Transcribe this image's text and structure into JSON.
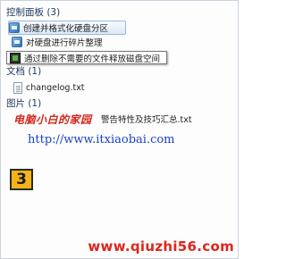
{
  "groups": {
    "control_panel": {
      "header": "控制面板 (3)",
      "items": [
        {
          "label": "创建并格式化硬盘分区",
          "icon": "control-panel-icon"
        },
        {
          "label": "对硬盘进行碎片整理",
          "icon": "control-panel-icon"
        },
        {
          "label": "通过删除不需要的文件释放磁盘空间",
          "icon": "disk-cleanup-icon"
        }
      ]
    },
    "documents": {
      "header": "文档 (1)",
      "items": [
        {
          "label": "changelog.txt",
          "icon": "text-document-icon"
        }
      ]
    },
    "pictures": {
      "header": "图片 (1)",
      "items": [
        {
          "label": "警告特性及技巧汇总.txt",
          "icon": "text-document-icon"
        }
      ]
    }
  },
  "overlay": {
    "site_name": "电脑小白的家园",
    "url": "http://www.itxiaobai.com",
    "step_number": "3",
    "watermark": "www.qiuzhi56.com"
  },
  "colors": {
    "header_text": "#1e395b",
    "highlight_border": "#9ab8dc",
    "overlay_red": "#d4271c",
    "url_blue": "#1a3fd0",
    "badge_fill": "#f5b416",
    "watermark_red": "#e0251b"
  }
}
